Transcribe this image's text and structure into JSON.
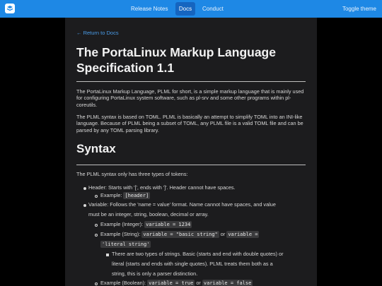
{
  "nav": {
    "logo_icon": "docs-logo-icon",
    "links": [
      "Release Notes",
      "Docs",
      "Conduct"
    ],
    "toggle": "Toggle theme"
  },
  "page": {
    "back_link": "← Return to Docs",
    "title": "The PortaLinux Markup Language Specification 1.1",
    "intro1": "The PortaLinux Markup Language, PLML for short, is a simple markup language that is mainly used for configuring PortaLinux system software, such as pl-srv and some other programs within pl-coreutils.",
    "intro2": "The PLML syntax is based on TOML. PLML is basically an attempt to simplify TOML into an INI-like language. Because of PLML being a subset of TOML, any PLML file is a valid TOML file and can be parsed by any TOML parsing library.",
    "syntax_heading": "Syntax",
    "syntax_intro": "The PLML syntax only has three types of tokens:",
    "header_item": "Header: Starts with '[', ends with ']'. Header cannot have spaces.",
    "header_example_label": "Example:",
    "header_example_code": "[header]",
    "variable_item_1": "Variable: Follows the 'name = value' format. Name cannot have spaces, and value",
    "variable_item_2": "must be an integer, string, boolean, decimal or array.",
    "ex_integer_label": "Example (Integer):",
    "ex_integer_code": "variable = 1234",
    "ex_string_label": "Example (String):",
    "ex_string_code1": "variable = \"basic string\"",
    "ex_string_or": "or",
    "ex_string_code2a": "variable =",
    "ex_string_code2b": "'literal string'",
    "string_note_1": "There are two types of strings. Basic (starts and end with double quotes) or",
    "string_note_2": "literal (starts and ends with single quotes). PLML treats them both as a",
    "string_note_3": "string, this is only a parser distinction.",
    "ex_boolean_label": "Example (Boolean):",
    "ex_boolean_code1": "variable = true",
    "ex_boolean_or": "or",
    "ex_boolean_code2": "variable = false"
  }
}
